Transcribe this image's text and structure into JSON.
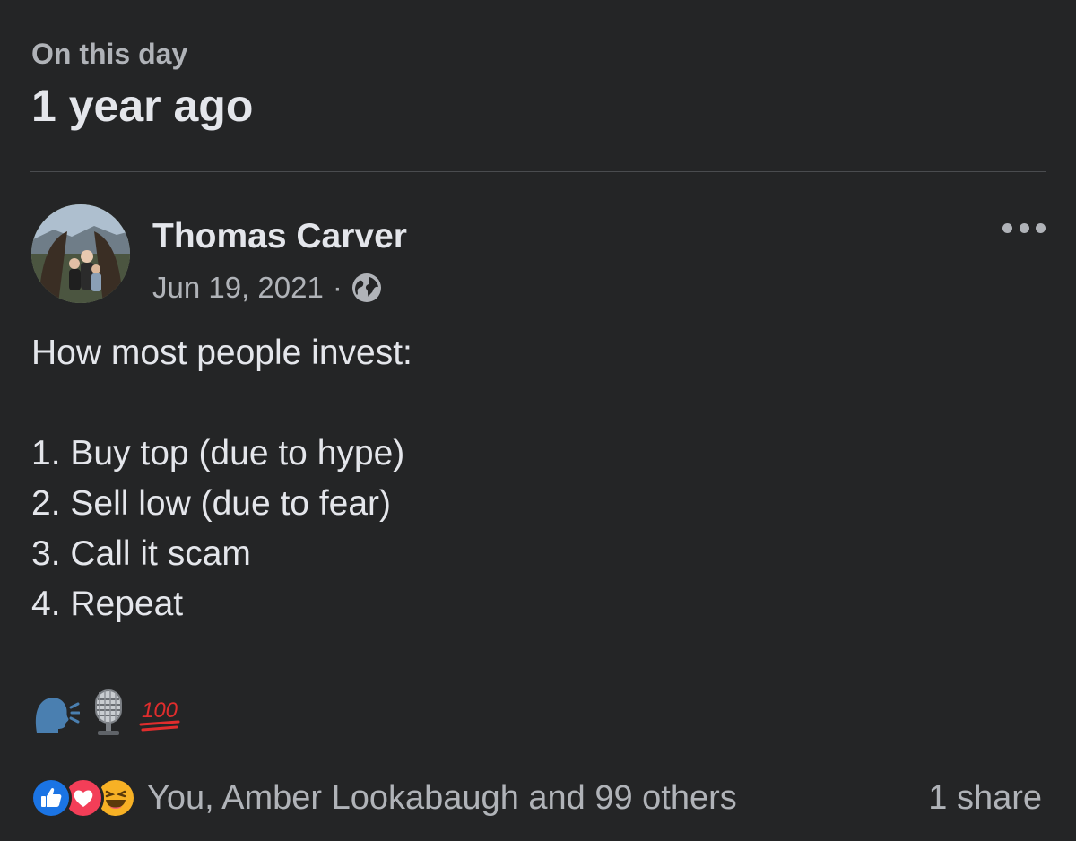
{
  "memory": {
    "kicker": "On this day",
    "title": "1 year ago"
  },
  "post": {
    "author": "Thomas Carver",
    "date": "Jun 19, 2021",
    "separator": "·",
    "privacy_icon": "globe-icon",
    "more_icon": "more-options-icon",
    "body_lines": [
      "How most people invest:",
      "",
      "1. Buy top (due to hype)",
      "2. Sell low (due to fear)",
      "3. Call it scam",
      "4. Repeat"
    ],
    "emojis": [
      "speaking-head-icon",
      "microphone-icon",
      "hundred-points-icon"
    ],
    "emoji_100_text": "100"
  },
  "footer": {
    "reaction_icons": [
      "like-icon",
      "love-icon",
      "haha-icon"
    ],
    "reactions_text": "You, Amber Lookabaugh and 99 others",
    "shares_text": "1 share"
  },
  "colors": {
    "background": "#242526",
    "primary_text": "#e4e6eb",
    "secondary_text": "#b0b3b8",
    "like_blue": "#1b74e4",
    "love_red": "#f33e58",
    "haha_yellow": "#f7b125"
  }
}
